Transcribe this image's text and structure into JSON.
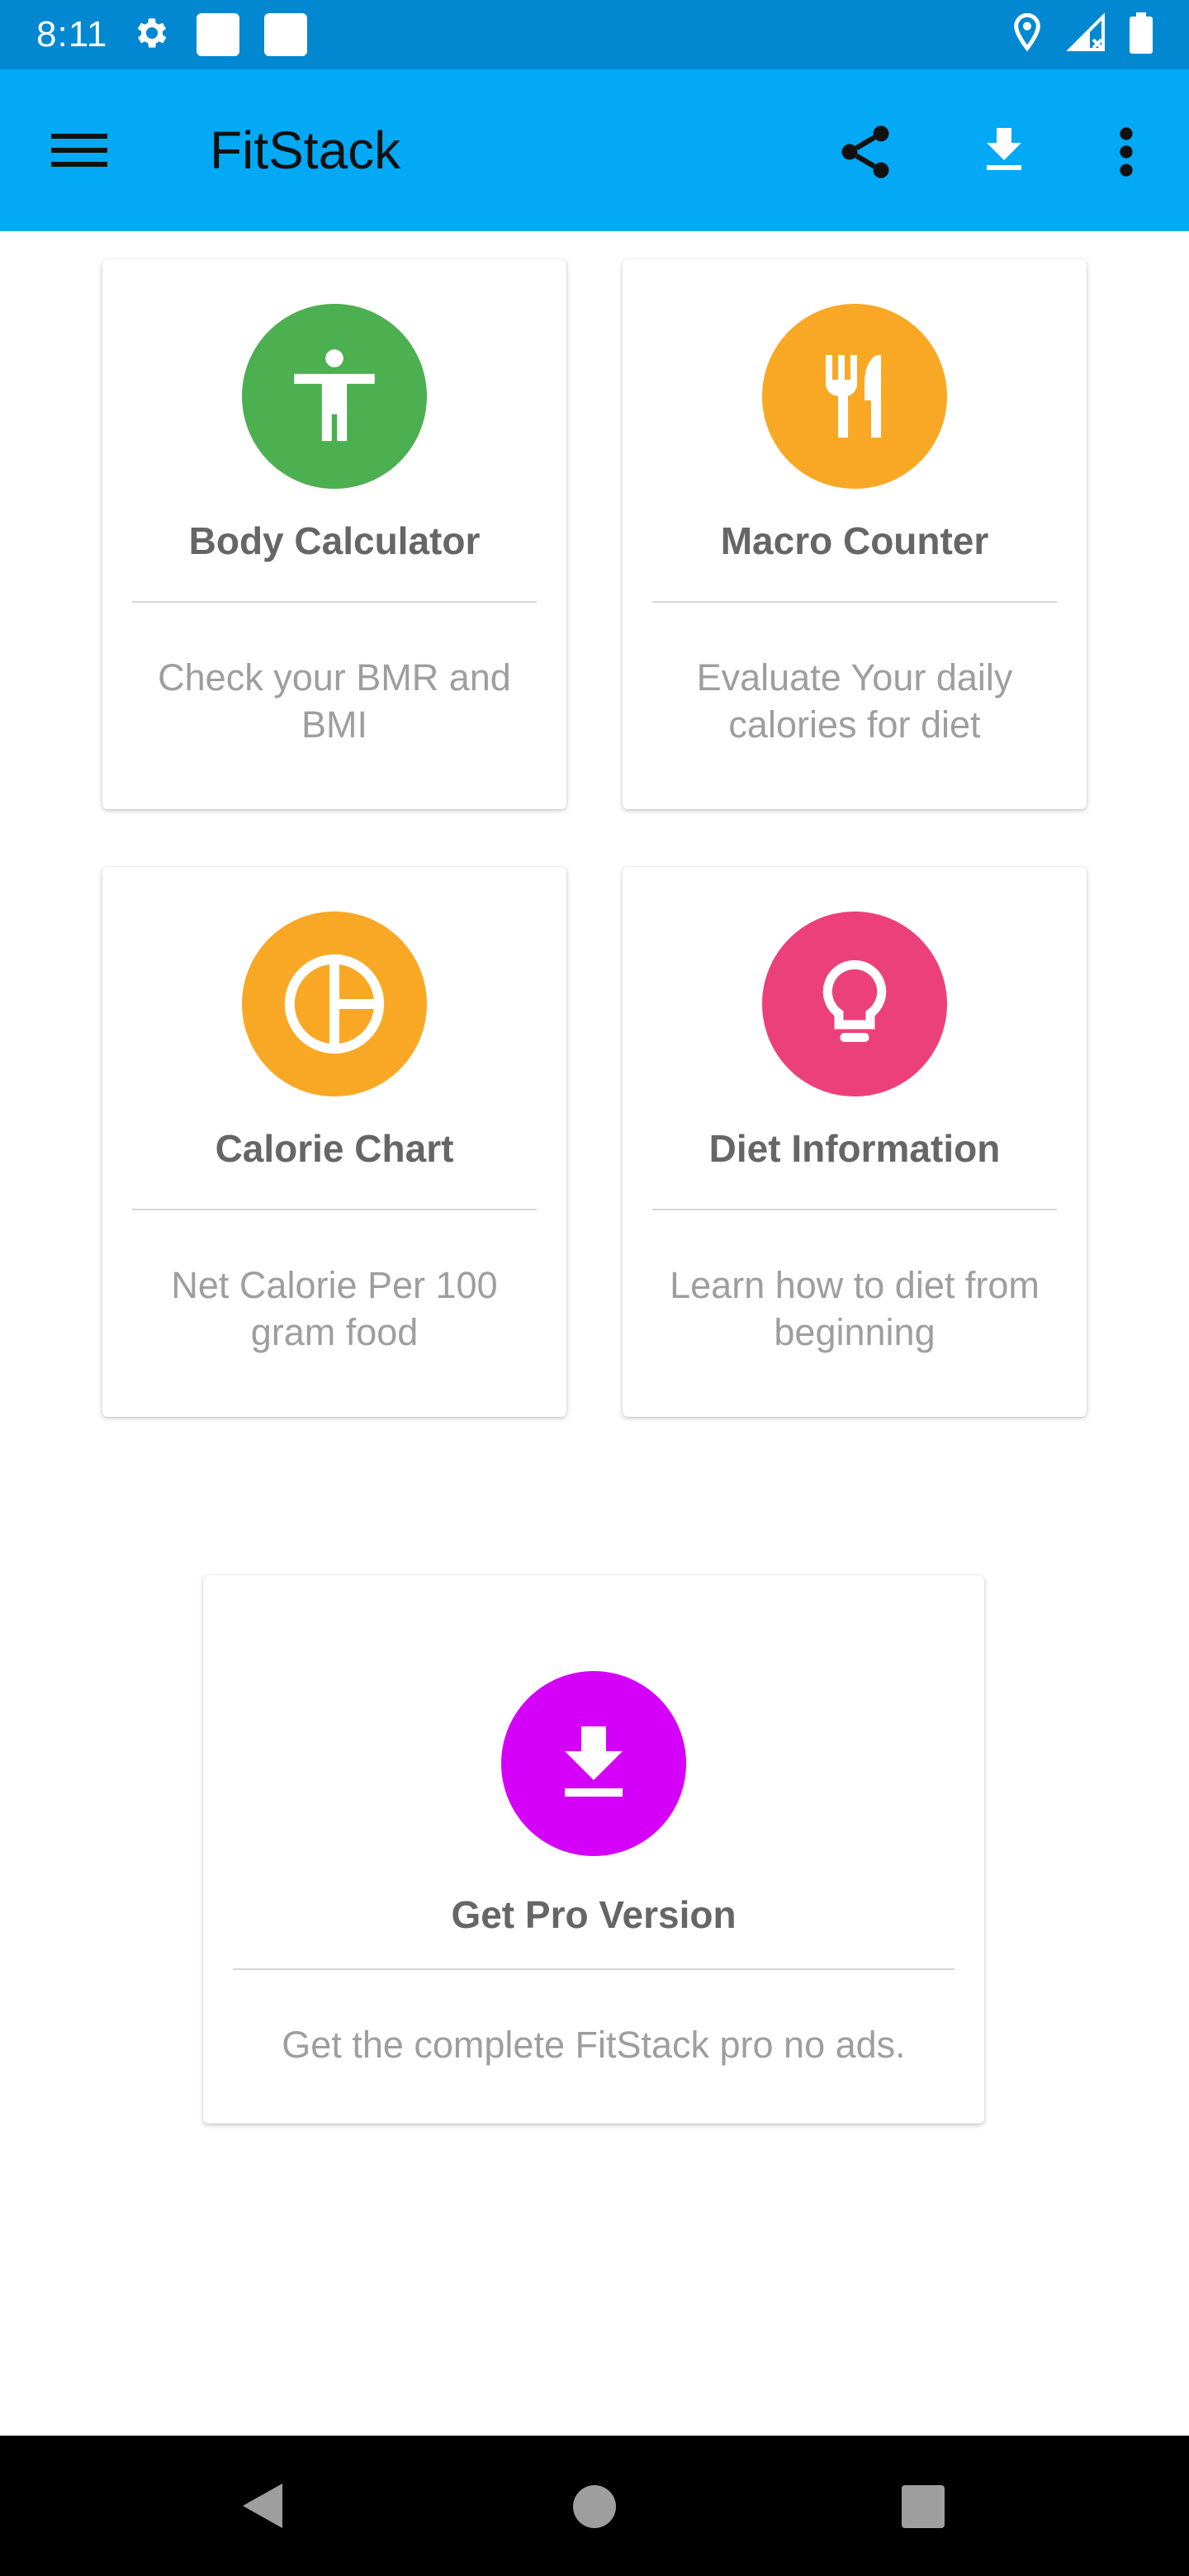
{
  "status_bar": {
    "time": "8:11",
    "icons": [
      "gear-icon",
      "notification-square-icon",
      "notification-square-icon",
      "location-icon",
      "signal-icon",
      "battery-icon"
    ]
  },
  "app_bar": {
    "title": "FitStack",
    "background": "#03a9f4",
    "actions": [
      "menu-icon",
      "share-icon",
      "download-icon",
      "more-vert-icon"
    ]
  },
  "cards": [
    {
      "title": "Body Calculator",
      "description": "Check your BMR and BMI",
      "icon": "accessibility-icon",
      "color": "#4caf50"
    },
    {
      "title": "Macro Counter",
      "description": "Evaluate Your daily calories for diet",
      "icon": "restaurant-icon",
      "color": "#f9a825"
    },
    {
      "title": "Calorie Chart",
      "description": "Net Calorie Per 100 gram food",
      "icon": "pie-chart-icon",
      "color": "#f9a825"
    },
    {
      "title": "Diet Information",
      "description": "Learn how to diet from beginning",
      "icon": "lightbulb-icon",
      "color": "#ec407a"
    },
    {
      "title": "Get Pro Version",
      "description": "Get the complete FitStack pro no ads.",
      "icon": "download-icon",
      "color": "#d500f9"
    }
  ],
  "nav_bar": {
    "buttons": [
      "back-icon",
      "home-icon",
      "recents-icon"
    ]
  }
}
